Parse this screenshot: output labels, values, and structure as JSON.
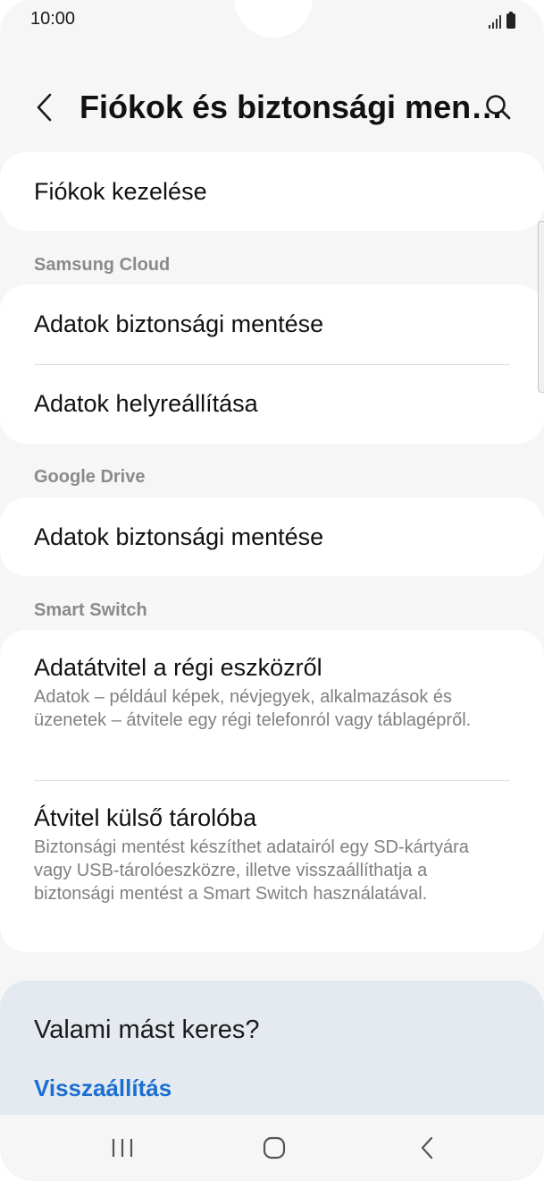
{
  "status_bar": {
    "time": "10:00"
  },
  "header": {
    "title": "Fiókok és biztonsági men…"
  },
  "sections": {
    "accounts_item": "Fiókok kezelése",
    "samsung_cloud": {
      "header": "Samsung Cloud",
      "backup": "Adatok biztonsági mentése",
      "restore": "Adatok helyreállítása"
    },
    "google_drive": {
      "header": "Google Drive",
      "backup": "Adatok biztonsági mentése"
    },
    "smart_switch": {
      "header": "Smart Switch",
      "transfer_title": "Adatátvitel a régi eszközről",
      "transfer_sub": "Adatok – például képek, névjegyek, alkalmazások és üzenetek – átvitele egy régi telefonról vagy táblagépről.",
      "external_title": "Átvitel külső tárolóba",
      "external_sub": "Biztonsági mentést készíthet adatairól egy SD-kártyára vagy USB-tárolóeszközre, illetve visszaállíthatja a biztonsági mentést a Smart Switch használatával."
    }
  },
  "suggestion": {
    "title": "Valami mást keres?",
    "link": "Visszaállítás"
  },
  "colors": {
    "background": "#f6f6f6",
    "card": "#ffffff",
    "link": "#1b6fd1",
    "suggestion_bg": "#e5eaf1"
  },
  "icons": {
    "back": "chevron-left-icon",
    "search": "search-icon",
    "nav_recents": "recents-icon",
    "nav_home": "home-icon",
    "nav_back": "back-icon"
  }
}
